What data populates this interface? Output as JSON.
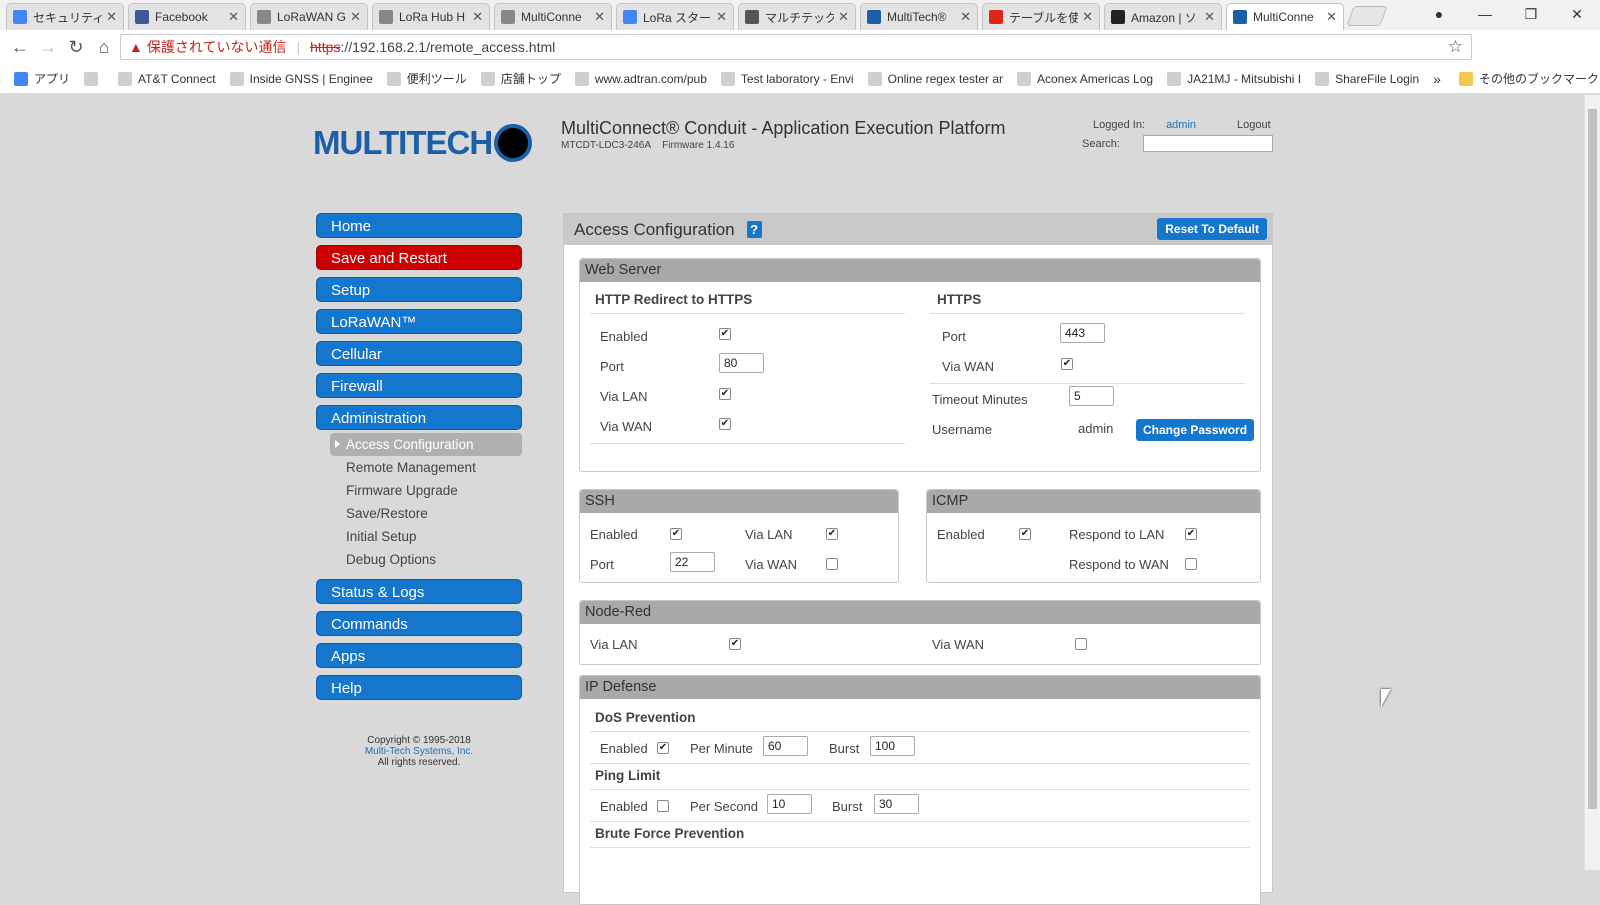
{
  "browser": {
    "tabs": [
      {
        "title": "セキュリティ診",
        "icon": "google-icon",
        "color": "#4285f4"
      },
      {
        "title": "Facebook",
        "icon": "facebook-icon",
        "color": "#3b5998"
      },
      {
        "title": "LoRaWAN G",
        "icon": "document-icon",
        "color": "#888888"
      },
      {
        "title": "LoRa Hub H",
        "icon": "document-icon",
        "color": "#888888"
      },
      {
        "title": "MultiConne",
        "icon": "document-icon",
        "color": "#888888"
      },
      {
        "title": "LoRa スター",
        "icon": "google-icon",
        "color": "#4285f4"
      },
      {
        "title": "マルチテック L",
        "icon": "printer-icon",
        "color": "#555555"
      },
      {
        "title": "MultiTech®",
        "icon": "multitech-icon",
        "color": "#1b5fa8"
      },
      {
        "title": "テーブルを使用",
        "icon": "adobe-icon",
        "color": "#e2231a"
      },
      {
        "title": "Amazon | ソ",
        "icon": "amazon-icon",
        "color": "#222222"
      },
      {
        "title": "MultiConne",
        "icon": "multitech-icon",
        "color": "#1b5fa8",
        "active": true
      }
    ],
    "address": {
      "warning": "保護されていない通信",
      "scheme": "https",
      "rest": "://192.168.2.1/remote_access.html"
    },
    "bookmarks": [
      {
        "label": "アプリ",
        "icon": "apps-icon"
      },
      {
        "label": "",
        "icon": "document-icon"
      },
      {
        "label": "AT&T Connect",
        "icon": "document-icon"
      },
      {
        "label": "Inside GNSS | Enginee",
        "icon": "gnss-icon"
      },
      {
        "label": "便利ツール",
        "icon": "document-icon"
      },
      {
        "label": "店舗トップ",
        "icon": "store-icon"
      },
      {
        "label": "www.adtran.com/pub",
        "icon": "adtran-icon"
      },
      {
        "label": "Test laboratory - Envi",
        "icon": "wifi-icon"
      },
      {
        "label": "Online regex tester ar",
        "icon": "regex-icon"
      },
      {
        "label": "Aconex Americas Log",
        "icon": "aconex-icon"
      },
      {
        "label": "JA21MJ - Mitsubishi I",
        "icon": "github-icon"
      },
      {
        "label": "ShareFile Login",
        "icon": "sharefile-icon"
      }
    ],
    "bookmarks_more": "»",
    "other_bookmarks": "その他のブックマーク"
  },
  "header": {
    "logo_text": "MULTITECH",
    "title": "MultiConnect® Conduit - Application Execution Platform",
    "model": "MTCDT-LDC3-246A",
    "firmware": "Firmware 1.4.16",
    "logged_in_label": "Logged In:",
    "user": "admin",
    "logout": "Logout",
    "search_label": "Search:"
  },
  "nav": {
    "items": [
      {
        "label": "Home"
      },
      {
        "label": "Save and Restart",
        "color": "#cc0000"
      },
      {
        "label": "Setup"
      },
      {
        "label": "LoRaWAN™"
      },
      {
        "label": "Cellular"
      },
      {
        "label": "Firewall"
      },
      {
        "label": "Administration"
      }
    ],
    "sub_items": [
      {
        "label": "Access Configuration",
        "active": true
      },
      {
        "label": "Remote Management"
      },
      {
        "label": "Firmware Upgrade"
      },
      {
        "label": "Save/Restore"
      },
      {
        "label": "Initial Setup"
      },
      {
        "label": "Debug Options"
      }
    ],
    "items_after": [
      {
        "label": "Status & Logs"
      },
      {
        "label": "Commands"
      },
      {
        "label": "Apps"
      },
      {
        "label": "Help"
      }
    ]
  },
  "copyright": {
    "line1": "Copyright © 1995-2018",
    "line2": "Multi-Tech Systems, Inc.",
    "line3": "All rights reserved."
  },
  "panel": {
    "title": "Access Configuration",
    "help": "?",
    "reset_button": "Reset To Default",
    "web_server": {
      "title": "Web Server",
      "redirect_title": "HTTP Redirect to HTTPS",
      "enabled_label": "Enabled",
      "enabled": true,
      "port_label": "Port",
      "port": "80",
      "via_lan_label": "Via LAN",
      "via_lan": true,
      "via_wan_label": "Via WAN",
      "via_wan": true,
      "https_title": "HTTPS",
      "https_port_label": "Port",
      "https_port": "443",
      "https_via_wan_label": "Via WAN",
      "https_via_wan": true,
      "timeout_label": "Timeout Minutes",
      "timeout": "5",
      "username_label": "Username",
      "username": "admin",
      "change_password": "Change Password"
    },
    "ssh": {
      "title": "SSH",
      "enabled_label": "Enabled",
      "enabled": true,
      "via_lan_label": "Via LAN",
      "via_lan": true,
      "port_label": "Port",
      "port": "22",
      "via_wan_label": "Via WAN",
      "via_wan": false
    },
    "icmp": {
      "title": "ICMP",
      "enabled_label": "Enabled",
      "enabled": true,
      "respond_lan_label": "Respond to LAN",
      "respond_lan": true,
      "respond_wan_label": "Respond to WAN",
      "respond_wan": false
    },
    "node_red": {
      "title": "Node-Red",
      "via_lan_label": "Via LAN",
      "via_lan": true,
      "via_wan_label": "Via WAN",
      "via_wan": false
    },
    "ip_defense": {
      "title": "IP Defense",
      "dos_title": "DoS Prevention",
      "dos_enabled_label": "Enabled",
      "dos_enabled": true,
      "per_minute_label": "Per Minute",
      "per_minute": "60",
      "dos_burst_label": "Burst",
      "dos_burst": "100",
      "ping_title": "Ping Limit",
      "ping_enabled_label": "Enabled",
      "ping_enabled": false,
      "per_second_label": "Per Second",
      "per_second": "10",
      "ping_burst_label": "Burst",
      "ping_burst": "30",
      "brute_title": "Brute Force Prevention"
    }
  }
}
